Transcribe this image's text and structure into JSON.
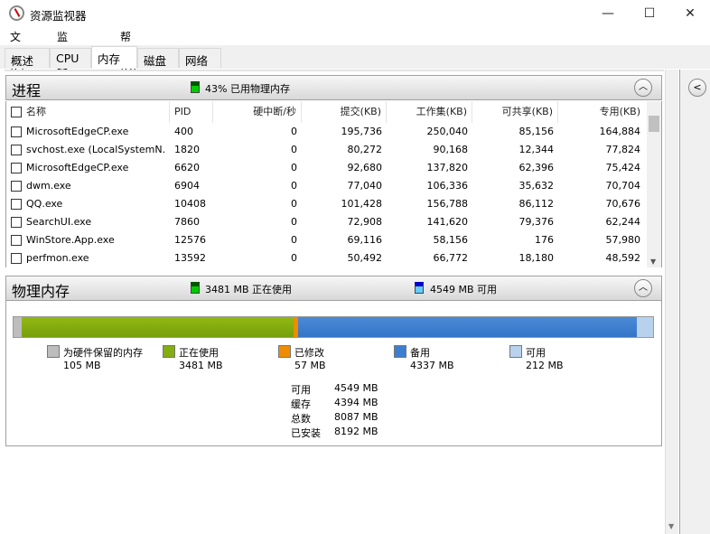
{
  "window": {
    "title": "资源监视器",
    "minimize": "—",
    "maximize": "☐",
    "close": "✕"
  },
  "menu": [
    "文件(F)",
    "监视器(M)",
    "帮助(H)"
  ],
  "tabs": [
    {
      "label": "概述",
      "active": false
    },
    {
      "label": "CPU",
      "active": false
    },
    {
      "label": "内存",
      "active": true
    },
    {
      "label": "磁盘",
      "active": false
    },
    {
      "label": "网络",
      "active": false
    }
  ],
  "processes": {
    "title": "进程",
    "summary": "43% 已用物理内存",
    "columns": [
      "名称",
      "PID",
      "硬中断/秒",
      "提交(KB)",
      "工作集(KB)",
      "可共享(KB)",
      "专用(KB)"
    ],
    "rows": [
      [
        "MicrosoftEdgeCP.exe",
        "400",
        "0",
        "195,736",
        "250,040",
        "85,156",
        "164,884"
      ],
      [
        "svchost.exe (LocalSystemN...",
        "1820",
        "0",
        "80,272",
        "90,168",
        "12,344",
        "77,824"
      ],
      [
        "MicrosoftEdgeCP.exe",
        "6620",
        "0",
        "92,680",
        "137,820",
        "62,396",
        "75,424"
      ],
      [
        "dwm.exe",
        "6904",
        "0",
        "77,040",
        "106,336",
        "35,632",
        "70,704"
      ],
      [
        "QQ.exe",
        "10408",
        "0",
        "101,428",
        "156,788",
        "86,112",
        "70,676"
      ],
      [
        "SearchUI.exe",
        "7860",
        "0",
        "72,908",
        "141,620",
        "79,376",
        "62,244"
      ],
      [
        "WinStore.App.exe",
        "12576",
        "0",
        "69,116",
        "58,156",
        "176",
        "57,980"
      ],
      [
        "perfmon.exe",
        "13592",
        "0",
        "50,492",
        "66,772",
        "18,180",
        "48,592"
      ]
    ]
  },
  "memory": {
    "title": "物理内存",
    "in_use_summary": "3481 MB 正在使用",
    "available_summary": "4549 MB 可用",
    "legend": [
      {
        "label": "为硬件保留的内存",
        "value": "105 MB",
        "mb": 105,
        "color": "#bdbdbd"
      },
      {
        "label": "正在使用",
        "value": "3481 MB",
        "mb": 3481,
        "color": "#84ad10"
      },
      {
        "label": "已修改",
        "value": "57 MB",
        "mb": 57,
        "color": "#f08c00"
      },
      {
        "label": "备用",
        "value": "4337 MB",
        "mb": 4337,
        "color": "#3d7fcf"
      },
      {
        "label": "可用",
        "value": "212 MB",
        "mb": 212,
        "color": "#b8d2ee"
      }
    ],
    "stats": [
      {
        "label": "可用",
        "value": "4549 MB"
      },
      {
        "label": "缓存",
        "value": "4394 MB"
      },
      {
        "label": "总数",
        "value": "8087 MB"
      },
      {
        "label": "已安装",
        "value": "8192 MB"
      }
    ]
  }
}
